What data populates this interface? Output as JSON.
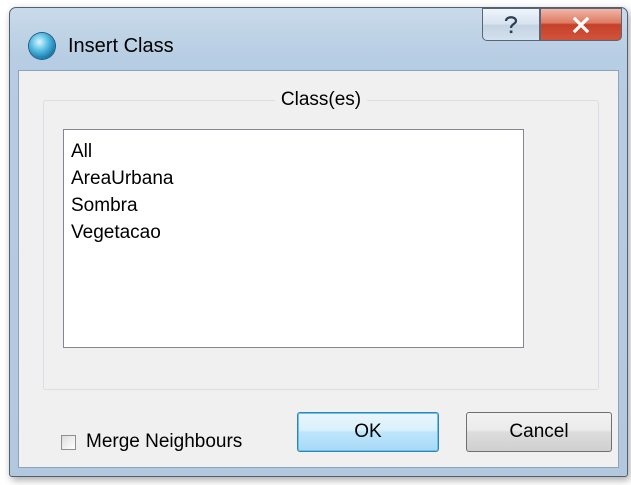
{
  "window": {
    "title": "Insert Class",
    "help_label": "?",
    "close_label": "X"
  },
  "group": {
    "title": "Class(es)"
  },
  "classes": [
    "All",
    "AreaUrbana",
    "Sombra",
    "Vegetacao"
  ],
  "merge_neighbours": {
    "label": "Merge Neighbours",
    "checked": false
  },
  "buttons": {
    "ok": "OK",
    "cancel": "Cancel"
  }
}
